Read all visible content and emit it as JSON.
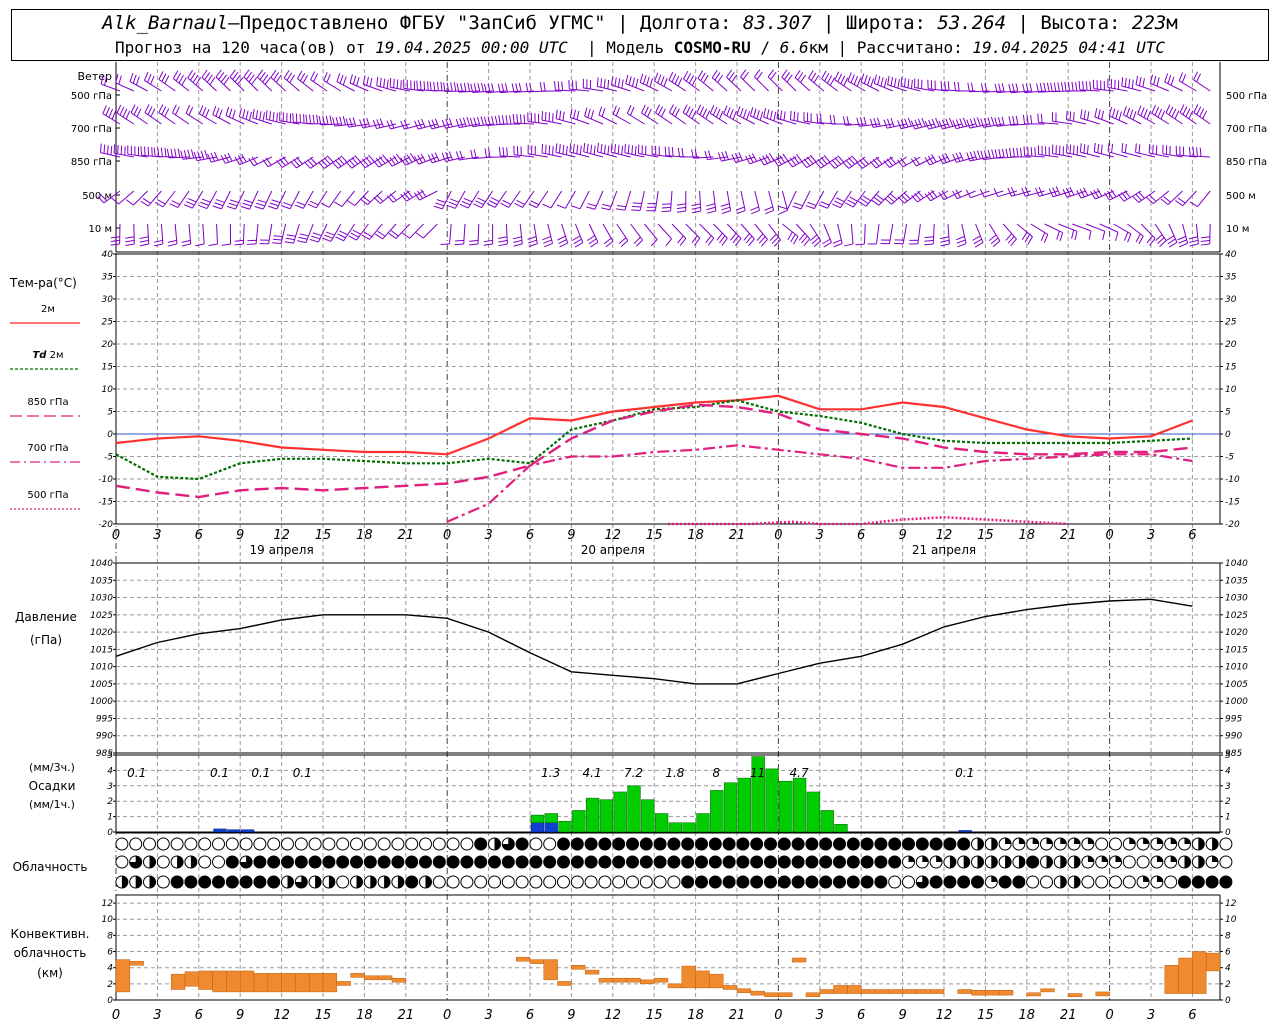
{
  "header": {
    "station": "Alk_Barnaul",
    "dash": " — ",
    "provider": "Предоставлено ФГБУ \"ЗапСиб УГМС\"",
    "lon_label": "Долгота:",
    "lon_value": "83.307",
    "lat_label": "Широта:",
    "lat_value": "53.264",
    "alt_label": "Высота:",
    "alt_value": "223",
    "alt_unit": "м",
    "forecast_label": "Прогноз на 120 часа(ов) от",
    "forecast_start": "19.04.2025 00:00 UTC",
    "model_label": "Модель",
    "model_name": "COSMO-RU",
    "model_res": "6.6",
    "model_res_unit": "км",
    "calc_label": "Рассчитано:",
    "calc_time": "19.04.2025 04:41 UTC"
  },
  "labels": {
    "wind": "Ветер",
    "wind_levels": [
      "500 гПа",
      "700 гПа",
      "850 гПа",
      "500 м",
      "10  м"
    ],
    "temp_title": "Тем-ра(°C)",
    "temp_legend": [
      {
        "name": "2м",
        "prefix": "",
        "color": "#ff2020",
        "dash": ""
      },
      {
        "name": " 2м",
        "prefix": "Td",
        "color": "#007000",
        "dash": "3,2"
      },
      {
        "name": "850 гПа",
        "prefix": "",
        "color": "#e0207f",
        "dash": "12,5"
      },
      {
        "name": "700 гПа",
        "prefix": "",
        "color": "#e0207f",
        "dash": "10,4,2,4"
      },
      {
        "name": "500 гПа",
        "prefix": "",
        "color": "#e0207f",
        "dash": "2,2"
      }
    ],
    "pressure_title": "Давление",
    "pressure_unit": "(гПа)",
    "precip_unit3": "(мм/3ч.)",
    "precip_title": "Осадки",
    "precip_unit1": "(мм/1ч.)",
    "cloud_title": "Облачность",
    "conv_title1": "Конвективн.",
    "conv_title2": "облачность",
    "conv_unit": "(км)",
    "dates": [
      "19 апреля",
      "20 апреля",
      "21 апреля"
    ]
  },
  "chart_data": [
    {
      "type": "line",
      "title": "Тем-ра(°C)",
      "x_ticks": [
        "0",
        "3",
        "6",
        "9",
        "12",
        "15",
        "18",
        "21",
        "0",
        "3",
        "6",
        "9",
        "12",
        "15",
        "18",
        "21",
        "0",
        "3",
        "6",
        "9",
        "12",
        "15",
        "18",
        "21",
        "0",
        "3",
        "6"
      ],
      "ylim": [
        -20,
        40
      ],
      "y_ticks": [
        40,
        35,
        30,
        25,
        20,
        15,
        10,
        5,
        0,
        -5,
        -10,
        -15,
        -20
      ],
      "grid": true,
      "series": [
        {
          "name": "2м",
          "x": [
            0,
            3,
            6,
            9,
            12,
            15,
            18,
            21,
            24,
            27,
            30,
            33,
            36,
            39,
            42,
            45,
            48,
            51,
            54,
            57,
            60,
            63,
            66,
            69,
            72,
            75,
            78
          ],
          "values": [
            -2,
            -1,
            -0.5,
            -1.5,
            -3,
            -3.5,
            -4,
            -4,
            -4.5,
            -1,
            3.5,
            3,
            5,
            6,
            7,
            7.5,
            8.5,
            5.5,
            5.5,
            7,
            6,
            3.5,
            1,
            -0.5,
            -1,
            -0.5,
            3
          ]
        },
        {
          "name": "Td 2м",
          "x": [
            0,
            3,
            6,
            9,
            12,
            15,
            18,
            21,
            24,
            27,
            30,
            33,
            36,
            39,
            42,
            45,
            48,
            51,
            54,
            57,
            60,
            63,
            66,
            69,
            72,
            75,
            78
          ],
          "values": [
            -4.5,
            -9.5,
            -10,
            -6.5,
            -5.5,
            -5.5,
            -6,
            -6.5,
            -6.5,
            -5.5,
            -6.5,
            1,
            3,
            5.5,
            6,
            7.5,
            5,
            4,
            2.5,
            0,
            -1.5,
            -2,
            -2,
            -2,
            -2,
            -1.5,
            -1
          ]
        },
        {
          "name": "850 гПа",
          "x": [
            0,
            3,
            6,
            9,
            12,
            15,
            18,
            21,
            24,
            27,
            30,
            33,
            36,
            39,
            42,
            45,
            48,
            51,
            54,
            57,
            60,
            63,
            66,
            69,
            72,
            75,
            78
          ],
          "values": [
            -11.5,
            -13,
            -14,
            -12.5,
            -12,
            -12.5,
            -12,
            -11.5,
            -11,
            -9.5,
            -7,
            -1,
            3,
            5,
            6.5,
            6,
            4.5,
            1,
            0,
            -1,
            -3,
            -4,
            -4.5,
            -4.5,
            -4,
            -4,
            -3
          ]
        },
        {
          "name": "700 гПа",
          "x": [
            24,
            27,
            30,
            33,
            36,
            39,
            42,
            45,
            48,
            51,
            54,
            57,
            60,
            63,
            66,
            69,
            72,
            75,
            78
          ],
          "values": [
            -19.5,
            -15.5,
            -7,
            -5,
            -5,
            -4,
            -3.5,
            -2.5,
            -3.5,
            -4.5,
            -5.5,
            -7.5,
            -7.5,
            -6,
            -5.5,
            -5,
            -4.5,
            -4.5,
            -6
          ]
        },
        {
          "name": "500 гПа",
          "x": [
            40,
            43,
            46,
            49,
            51,
            54,
            57,
            60,
            63,
            66,
            69
          ],
          "values": [
            -20,
            -20,
            -20,
            -19.5,
            -20,
            -20,
            -19,
            -18.5,
            -19,
            -19.5,
            -20
          ]
        }
      ]
    },
    {
      "type": "line",
      "title": "Давление",
      "ylabel": "(гПа)",
      "ylim": [
        985,
        1040
      ],
      "y_ticks": [
        1040,
        1035,
        1030,
        1025,
        1020,
        1015,
        1010,
        1005,
        1000,
        995,
        990,
        985
      ],
      "series": [
        {
          "name": "pressure",
          "x": [
            0,
            3,
            6,
            9,
            12,
            15,
            18,
            21,
            24,
            27,
            30,
            33,
            36,
            39,
            42,
            45,
            48,
            51,
            54,
            57,
            60,
            63,
            66,
            69,
            72,
            75,
            78
          ],
          "values": [
            1013,
            1017,
            1019.5,
            1021,
            1023.5,
            1025,
            1025,
            1025,
            1024,
            1020,
            1014,
            1008.5,
            1007.5,
            1006.5,
            1005,
            1005,
            1008,
            1011,
            1013,
            1016.5,
            1021.5,
            1024.5,
            1026.5,
            1028,
            1029,
            1029.5,
            1027.5
          ]
        }
      ]
    },
    {
      "type": "bar",
      "title": "Осадки",
      "ylim": [
        0,
        5
      ],
      "y_ticks": [
        5,
        4,
        3,
        2,
        1,
        0
      ],
      "totals_3h": [
        {
          "x": 1.5,
          "label": "0.1"
        },
        {
          "x": 7.5,
          "label": "0.1"
        },
        {
          "x": 10.5,
          "label": "0.1"
        },
        {
          "x": 13.5,
          "label": "0.1"
        },
        {
          "x": 31.5,
          "label": "1.3"
        },
        {
          "x": 34.5,
          "label": "4.1"
        },
        {
          "x": 37.5,
          "label": "7.2"
        },
        {
          "x": 40.5,
          "label": "1.8"
        },
        {
          "x": 43.5,
          "label": "8"
        },
        {
          "x": 46.5,
          "label": "11"
        },
        {
          "x": 49.5,
          "label": "4.7"
        },
        {
          "x": 61.5,
          "label": "0.1"
        }
      ],
      "hourly_rain": [
        0,
        0,
        0,
        0,
        0,
        0,
        0,
        0,
        0,
        0,
        0,
        0,
        0,
        0,
        0,
        0,
        0,
        0,
        0,
        0,
        0,
        0,
        0,
        0,
        0,
        0,
        0,
        0,
        0,
        0,
        0.5,
        0.6,
        0.7,
        1.4,
        2.2,
        2.1,
        2.6,
        3,
        2.1,
        1.2,
        0.6,
        0.6,
        1.2,
        2.7,
        3.2,
        3.5,
        4.9,
        4.1,
        3.3,
        3.5,
        2.6,
        1.4,
        0.5,
        0,
        0,
        0,
        0,
        0,
        0,
        0,
        0,
        0,
        0,
        0,
        0,
        0,
        0,
        0,
        0,
        0,
        0,
        0,
        0,
        0,
        0,
        0,
        0,
        0,
        0,
        0
      ],
      "hourly_snow": [
        0,
        0,
        0,
        0,
        0,
        0,
        0,
        0.2,
        0.15,
        0.15,
        0,
        0,
        0,
        0,
        0,
        0,
        0,
        0,
        0,
        0,
        0,
        0,
        0,
        0,
        0,
        0,
        0,
        0,
        0,
        0,
        0.6,
        0.6,
        0,
        0,
        0,
        0,
        0,
        0,
        0,
        0,
        0,
        0,
        0,
        0,
        0,
        0,
        0,
        0,
        0,
        0,
        0,
        0,
        0,
        0,
        0,
        0,
        0,
        0,
        0,
        0,
        0,
        0.1,
        0,
        0,
        0,
        0,
        0,
        0,
        0,
        0,
        0,
        0,
        0,
        0,
        0,
        0,
        0,
        0,
        0,
        0
      ],
      "rain_color": "#00cc00",
      "snow_color": "#1040d0"
    },
    {
      "type": "table",
      "title": "Облачность",
      "note": "cloud symbols per hour (0=clear, 1=quarter, 2=half, 3=three-quarter, 4=overcast), three rows",
      "rows": [
        "0000000000000000000000000042340044444444444444444444444444444422111111100111112200011224444",
        "0320220043444444444444444444444444444444444444444444444441112222224222111001122104444444444",
        "2220444444442322022224200000000000000000044444444444444400344441440022000011044444444444444"
      ]
    },
    {
      "type": "bar",
      "title": "Конвективн. облачность",
      "ylabel": "(км)",
      "ylim": [
        0,
        13
      ],
      "y_ticks": [
        12,
        10,
        8,
        6,
        4,
        2,
        0
      ],
      "color": "#f08a30",
      "segments": [
        {
          "h": 0,
          "base": 1,
          "top": 5
        },
        {
          "h": 1,
          "base": 4.3,
          "top": 4.8
        },
        {
          "h": 4,
          "base": 1.3,
          "top": 3.2
        },
        {
          "h": 5,
          "base": 1.7,
          "top": 3.5
        },
        {
          "h": 6,
          "base": 1.3,
          "top": 3.6
        },
        {
          "h": 7,
          "base": 1.0,
          "top": 3.6
        },
        {
          "h": 8,
          "base": 1.0,
          "top": 3.6
        },
        {
          "h": 9,
          "base": 1.0,
          "top": 3.6
        },
        {
          "h": 10,
          "base": 1.0,
          "top": 3.3
        },
        {
          "h": 11,
          "base": 1.0,
          "top": 3.3
        },
        {
          "h": 12,
          "base": 1.0,
          "top": 3.3
        },
        {
          "h": 13,
          "base": 1.0,
          "top": 3.3
        },
        {
          "h": 14,
          "base": 1.0,
          "top": 3.3
        },
        {
          "h": 15,
          "base": 1.0,
          "top": 3.3
        },
        {
          "h": 16,
          "base": 1.8,
          "top": 2.3
        },
        {
          "h": 17,
          "base": 2.8,
          "top": 3.3
        },
        {
          "h": 18,
          "base": 2.5,
          "top": 3.0
        },
        {
          "h": 19,
          "base": 2.5,
          "top": 3.0
        },
        {
          "h": 20,
          "base": 2.2,
          "top": 2.7
        },
        {
          "h": 29,
          "base": 4.8,
          "top": 5.3
        },
        {
          "h": 30,
          "base": 4.5,
          "top": 5.0
        },
        {
          "h": 31,
          "base": 2.5,
          "top": 5.0
        },
        {
          "h": 32,
          "base": 1.8,
          "top": 2.3
        },
        {
          "h": 33,
          "base": 3.8,
          "top": 4.3
        },
        {
          "h": 34,
          "base": 3.2,
          "top": 3.7
        },
        {
          "h": 35,
          "base": 2.2,
          "top": 2.7
        },
        {
          "h": 36,
          "base": 2.2,
          "top": 2.7
        },
        {
          "h": 37,
          "base": 2.2,
          "top": 2.7
        },
        {
          "h": 38,
          "base": 2.0,
          "top": 2.5
        },
        {
          "h": 39,
          "base": 2.2,
          "top": 2.7
        },
        {
          "h": 40,
          "base": 1.5,
          "top": 2.0
        },
        {
          "h": 41,
          "base": 1.5,
          "top": 4.2
        },
        {
          "h": 42,
          "base": 1.5,
          "top": 3.6
        },
        {
          "h": 43,
          "base": 1.5,
          "top": 3.2
        },
        {
          "h": 44,
          "base": 1.3,
          "top": 1.8
        },
        {
          "h": 45,
          "base": 0.9,
          "top": 1.4
        },
        {
          "h": 46,
          "base": 0.6,
          "top": 1.1
        },
        {
          "h": 47,
          "base": 0.4,
          "top": 0.9
        },
        {
          "h": 48,
          "base": 0.4,
          "top": 0.9
        },
        {
          "h": 49,
          "base": 4.7,
          "top": 5.2
        },
        {
          "h": 50,
          "base": 0.4,
          "top": 0.9
        },
        {
          "h": 51,
          "base": 0.8,
          "top": 1.3
        },
        {
          "h": 52,
          "base": 0.8,
          "top": 1.8
        },
        {
          "h": 53,
          "base": 0.8,
          "top": 1.8
        },
        {
          "h": 54,
          "base": 0.8,
          "top": 1.3
        },
        {
          "h": 55,
          "base": 0.8,
          "top": 1.3
        },
        {
          "h": 56,
          "base": 0.8,
          "top": 1.3
        },
        {
          "h": 57,
          "base": 0.8,
          "top": 1.3
        },
        {
          "h": 58,
          "base": 0.8,
          "top": 1.3
        },
        {
          "h": 59,
          "base": 0.8,
          "top": 1.3
        },
        {
          "h": 61,
          "base": 0.8,
          "top": 1.3
        },
        {
          "h": 62,
          "base": 0.6,
          "top": 1.2
        },
        {
          "h": 63,
          "base": 0.6,
          "top": 1.2
        },
        {
          "h": 64,
          "base": 0.6,
          "top": 1.2
        },
        {
          "h": 66,
          "base": 0.5,
          "top": 0.9
        },
        {
          "h": 67,
          "base": 1.0,
          "top": 1.4
        },
        {
          "h": 69,
          "base": 0.4,
          "top": 0.8
        },
        {
          "h": 71,
          "base": 0.5,
          "top": 1.0
        },
        {
          "h": 76,
          "base": 0.8,
          "top": 4.3
        },
        {
          "h": 77,
          "base": 0.8,
          "top": 5.2
        },
        {
          "h": 78,
          "base": 0.8,
          "top": 6.0
        },
        {
          "h": 79,
          "base": 3.6,
          "top": 5.8
        }
      ]
    }
  ],
  "wind_color": "#8000c8"
}
